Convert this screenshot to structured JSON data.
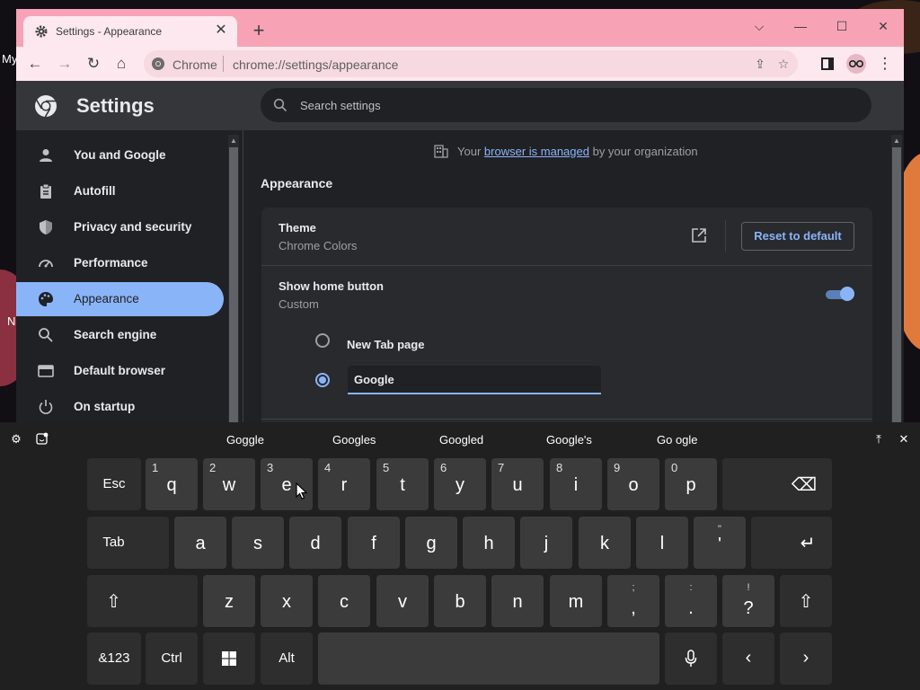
{
  "desktop": {
    "left_fragments": [
      "My",
      "N"
    ]
  },
  "browser": {
    "tab_title": "Settings - Appearance",
    "tab_close": "✕",
    "new_tab": "+",
    "window_controls": {
      "dropdown": "⌵",
      "minimize": "—",
      "maximize": "☐",
      "close": "✕"
    },
    "omnibox_label": "Chrome",
    "url": "chrome://settings/appearance",
    "accent_color": "#f7a3b5"
  },
  "settings": {
    "title": "Settings",
    "search_placeholder": "Search settings",
    "nav_items": [
      {
        "label": "You and Google",
        "icon": "person-icon"
      },
      {
        "label": "Autofill",
        "icon": "clipboard-icon"
      },
      {
        "label": "Privacy and security",
        "icon": "shield-icon"
      },
      {
        "label": "Performance",
        "icon": "speedometer-icon"
      },
      {
        "label": "Appearance",
        "icon": "palette-icon",
        "active": true
      },
      {
        "label": "Search engine",
        "icon": "search-icon"
      },
      {
        "label": "Default browser",
        "icon": "browser-icon"
      },
      {
        "label": "On startup",
        "icon": "power-icon"
      }
    ],
    "managed_notice": {
      "prefix": "Your",
      "link": "browser is managed",
      "suffix": "by your organization"
    },
    "section_title": "Appearance",
    "theme": {
      "title": "Theme",
      "value": "Chrome Colors",
      "reset_label": "Reset to default"
    },
    "home_button": {
      "title": "Show home button",
      "value": "Custom",
      "enabled": true,
      "options": [
        {
          "label": "New Tab page",
          "selected": false
        }
      ],
      "custom_url_value": "Google"
    }
  },
  "keyboard": {
    "suggestions": [
      "Goggle",
      "Googles",
      "Googled",
      "Google's",
      "Go ogle"
    ],
    "row1": {
      "esc": "Esc",
      "letters": [
        {
          "char": "q",
          "alt": "1"
        },
        {
          "char": "w",
          "alt": "2"
        },
        {
          "char": "e",
          "alt": "3"
        },
        {
          "char": "r",
          "alt": "4"
        },
        {
          "char": "t",
          "alt": "5"
        },
        {
          "char": "y",
          "alt": "6"
        },
        {
          "char": "u",
          "alt": "7"
        },
        {
          "char": "i",
          "alt": "8"
        },
        {
          "char": "o",
          "alt": "9"
        },
        {
          "char": "p",
          "alt": "0"
        }
      ],
      "backspace": "⌫"
    },
    "row2": {
      "tab": "Tab",
      "letters": [
        "a",
        "s",
        "d",
        "f",
        "g",
        "h",
        "j",
        "k",
        "l"
      ],
      "quote_top": "\"",
      "quote_bottom": "'",
      "enter": "↵"
    },
    "row3": {
      "shift": "⇧",
      "letters": [
        "z",
        "x",
        "c",
        "v",
        "b",
        "n",
        "m"
      ],
      "comma_top": ";",
      "comma_bottom": ",",
      "period_top": ":",
      "period_bottom": ".",
      "question_top": "!",
      "question_bottom": "?"
    },
    "row4": {
      "symbols": "&123",
      "ctrl": "Ctrl",
      "alt": "Alt",
      "left": "‹",
      "right": "›"
    }
  }
}
